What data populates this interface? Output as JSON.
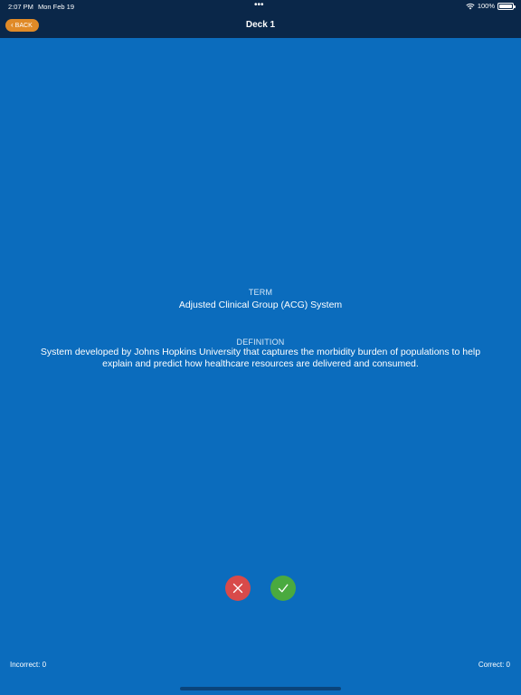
{
  "status_bar": {
    "time": "2:07 PM",
    "date": "Mon Feb 19",
    "dots": "•••",
    "battery": "100%",
    "icons": [
      "wifi-icon",
      "battery-icon"
    ]
  },
  "nav": {
    "back_label": "BACK",
    "back_icon": "chevron-left-icon",
    "title": "Deck 1"
  },
  "card": {
    "term_label": "TERM",
    "term": "Adjusted Clinical Group (ACG) System",
    "definition_label": "DEFINITION",
    "definition": "System developed by Johns Hopkins University that captures the morbidity burden of populations to help explain and predict how healthcare resources are delivered and consumed."
  },
  "answers": {
    "incorrect_icon": "x-icon",
    "correct_icon": "check-icon"
  },
  "score": {
    "incorrect": "Incorrect: 0",
    "correct": "Correct: 0"
  },
  "colors": {
    "background": "#0b6cbd",
    "nav_background": "#0a2749",
    "back_button": "#e08a27",
    "incorrect_button": "#d84a4a",
    "correct_button": "#4aaa3f"
  }
}
